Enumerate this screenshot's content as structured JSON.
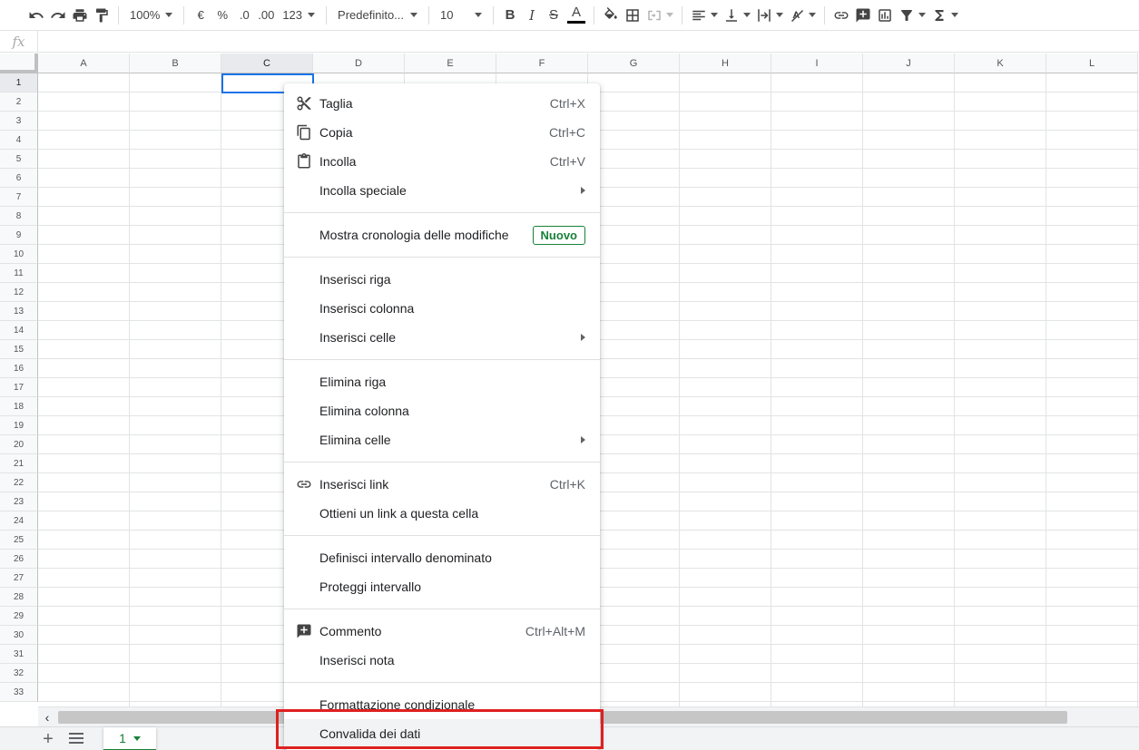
{
  "toolbar": {
    "zoom": "100%",
    "currency": "€",
    "percent": "%",
    "decrease_decimals": ".0",
    "increase_decimals": ".00",
    "more_formats": "123",
    "font": "Predefinito...",
    "font_size": "10",
    "bold": "B",
    "italic": "I",
    "strikethrough": "S",
    "text_color_letter": "A"
  },
  "formula_bar": {
    "fx_label": "fx"
  },
  "columns": [
    "A",
    "B",
    "C",
    "D",
    "E",
    "F",
    "G",
    "H",
    "I",
    "J",
    "K",
    "L"
  ],
  "selected_column": "C",
  "rows": [
    "1",
    "2",
    "3",
    "4",
    "5",
    "6",
    "7",
    "8",
    "9",
    "10",
    "11",
    "12",
    "13",
    "14",
    "15",
    "16",
    "17",
    "18",
    "19",
    "20",
    "21",
    "22",
    "23",
    "24",
    "25",
    "26",
    "27",
    "28",
    "29",
    "30",
    "31",
    "32",
    "33"
  ],
  "selected_row": "1",
  "context_menu": {
    "cut": {
      "label": "Taglia",
      "shortcut": "Ctrl+X"
    },
    "copy": {
      "label": "Copia",
      "shortcut": "Ctrl+C"
    },
    "paste": {
      "label": "Incolla",
      "shortcut": "Ctrl+V"
    },
    "paste_special": {
      "label": "Incolla speciale"
    },
    "version_history": {
      "label": "Mostra cronologia delle modifiche",
      "badge": "Nuovo"
    },
    "insert_row": {
      "label": "Inserisci riga"
    },
    "insert_column": {
      "label": "Inserisci colonna"
    },
    "insert_cells": {
      "label": "Inserisci celle"
    },
    "delete_row": {
      "label": "Elimina riga"
    },
    "delete_column": {
      "label": "Elimina colonna"
    },
    "delete_cells": {
      "label": "Elimina celle"
    },
    "insert_link": {
      "label": "Inserisci link",
      "shortcut": "Ctrl+K"
    },
    "get_cell_link": {
      "label": "Ottieni un link a questa cella"
    },
    "named_range": {
      "label": "Definisci intervallo denominato"
    },
    "protect_range": {
      "label": "Proteggi intervallo"
    },
    "comment": {
      "label": "Commento",
      "shortcut": "Ctrl+Alt+M"
    },
    "insert_note": {
      "label": "Inserisci nota"
    },
    "conditional_formatting": {
      "label": "Formattazione condizionale"
    },
    "data_validation": {
      "label": "Convalida dei dati"
    }
  },
  "sheet_tab": {
    "name": "1"
  },
  "colors": {
    "accent_green": "#188038",
    "selection_blue": "#1a73e8",
    "highlight_red": "#e02020"
  }
}
